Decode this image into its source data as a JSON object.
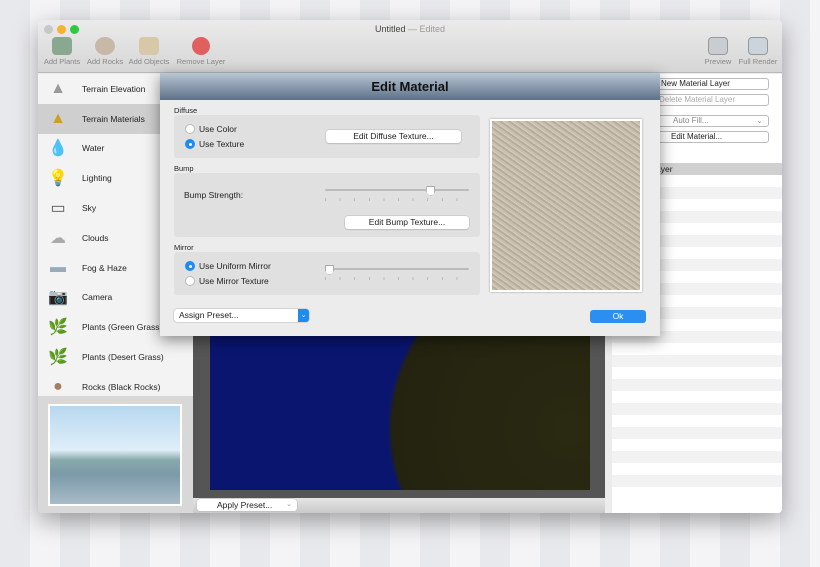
{
  "window": {
    "title": "Untitled",
    "status": "Edited"
  },
  "toolbar": {
    "left": [
      {
        "label": "Add Plants",
        "icon": "add-plants-icon"
      },
      {
        "label": "Add Rocks",
        "icon": "add-rocks-icon"
      },
      {
        "label": "Add Objects",
        "icon": "add-objects-icon"
      },
      {
        "label": "Remove Layer",
        "icon": "remove-layer-icon"
      }
    ],
    "right": [
      {
        "label": "Preview",
        "icon": "preview-icon"
      },
      {
        "label": "Full Render",
        "icon": "full-render-icon"
      }
    ]
  },
  "sidebar": {
    "items": [
      {
        "label": "Terrain Elevation",
        "icon": "terrain-elevation-icon"
      },
      {
        "label": "Terrain Materials",
        "icon": "terrain-materials-icon",
        "selected": true
      },
      {
        "label": "Water",
        "icon": "water-drop-icon"
      },
      {
        "label": "Lighting",
        "icon": "lightbulb-icon"
      },
      {
        "label": "Sky",
        "icon": "sky-icon"
      },
      {
        "label": "Clouds",
        "icon": "clouds-icon"
      },
      {
        "label": "Fog & Haze",
        "icon": "fog-icon"
      },
      {
        "label": "Camera",
        "icon": "camera-icon"
      },
      {
        "label": "Plants (Green Grass)",
        "icon": "plant-icon"
      },
      {
        "label": "Plants (Desert Grass)",
        "icon": "plant-icon"
      },
      {
        "label": "Rocks (Black Rocks)",
        "icon": "rock-icon"
      }
    ]
  },
  "canvas": {
    "apply_preset": "Apply Preset..."
  },
  "right_panel": {
    "new_layer": "New Material Layer",
    "delete_layer": "Delete Material Layer",
    "auto_fill": "Auto Fill...",
    "edit_material": "Edit Material...",
    "layer_row": "ayer"
  },
  "dialog": {
    "title": "Edit Material",
    "diffuse": {
      "label": "Diffuse",
      "use_color": "Use Color",
      "use_texture": "Use Texture",
      "selected": "Use Texture",
      "edit_button": "Edit Diffuse Texture..."
    },
    "bump": {
      "label": "Bump",
      "strength_label": "Bump Strength:",
      "strength_value": 0.75,
      "edit_button": "Edit Bump Texture..."
    },
    "mirror": {
      "label": "Mirror",
      "uniform": "Use Uniform Mirror",
      "texture": "Use Mirror Texture",
      "selected": "Use Uniform Mirror",
      "value": 0
    },
    "assign_preset": "Assign Preset...",
    "ok": "Ok"
  },
  "colors": {
    "accent": "#1e8cf0",
    "water": "#0a1570"
  }
}
